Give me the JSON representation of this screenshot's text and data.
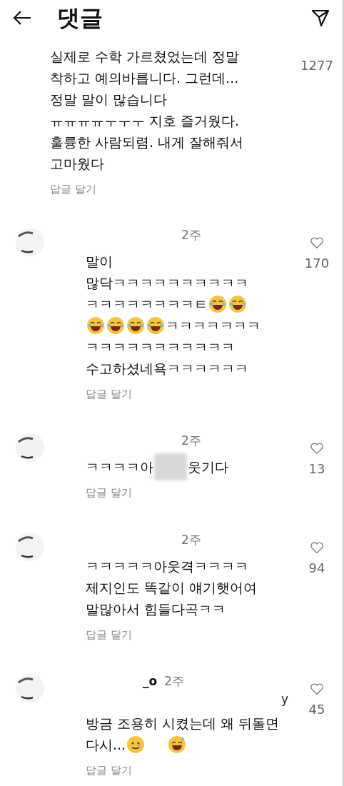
{
  "header": {
    "title": "댓글"
  },
  "comments": [
    {
      "likes": "1277",
      "reply": "답글 달기",
      "lines": [
        [
          {
            "kind": "text",
            "text": "실제로 수학 가르쳤었는데 정말"
          }
        ],
        [
          {
            "kind": "text",
            "text": "착하고 예의바릅니다. 그런데..."
          }
        ],
        [
          {
            "kind": "text",
            "text": "정말 말이 많습니다"
          }
        ],
        [
          {
            "kind": "text",
            "text": "ㅠㅠㅠㅠㅜㅜㅜ 지호 즐거웠다."
          }
        ],
        [
          {
            "kind": "text",
            "text": "훌륭한 사람되렴. 내게 잘해줘서"
          }
        ],
        [
          {
            "kind": "text",
            "text": "고마웠다"
          }
        ]
      ]
    },
    {
      "time": "2주",
      "likes": "170",
      "reply": "답글 달기",
      "lines": [
        [
          {
            "kind": "text",
            "text": "말이"
          }
        ],
        [
          {
            "kind": "text",
            "text": "많닥ㅋㅋㅋㅋㅋㅋㅋㅋㅋㅋ"
          }
        ],
        [
          {
            "kind": "text",
            "text": "ㅋㅋㅋㅋㅋㅋㅋㅋㅌ"
          },
          {
            "kind": "laughing"
          },
          {
            "kind": "laughing"
          }
        ],
        [
          {
            "kind": "laughing"
          },
          {
            "kind": "laughing"
          },
          {
            "kind": "laughing"
          },
          {
            "kind": "laughing"
          },
          {
            "kind": "text",
            "text": "ㅋㅋㅋㅋㅋㅋㅋ"
          }
        ],
        [
          {
            "kind": "text",
            "text": "ㅋㅋㅋㅋㅋㅋㅋㅋㅋㅋㅋ"
          }
        ],
        [
          {
            "kind": "text",
            "text": "수고하셨네욕ㅋㅋㅋㅋㅋㅋ"
          }
        ]
      ]
    },
    {
      "time": "2주",
      "likes": "13",
      "reply": "답글 달기",
      "lines": [
        [
          {
            "kind": "text",
            "text": "ㅋㅋㅋㅋ아"
          },
          {
            "kind": "blur"
          },
          {
            "kind": "text",
            "text": "웃기다"
          }
        ]
      ]
    },
    {
      "time": "2주",
      "likes": "94",
      "reply": "답글 달기",
      "lines": [
        [
          {
            "kind": "text",
            "text": "ㅋㅋㅋㅋㅋ아웃격ㅋㅋㅋㅋ"
          }
        ],
        [
          {
            "kind": "text",
            "text": "제지인도 똑같이 얘기햇어여"
          }
        ],
        [
          {
            "kind": "text",
            "text": "말많아서 힘들다곡ㅋㅋ"
          }
        ]
      ]
    },
    {
      "username": "_o",
      "time": "2주",
      "username_tail": "y",
      "likes": "45",
      "reply": "답글 달기",
      "lines": [
        [
          {
            "kind": "text",
            "text": "방금 조용히 시켰는데 왜 뒤돌면"
          }
        ],
        [
          {
            "kind": "text",
            "text": "다시..."
          },
          {
            "kind": "teary"
          },
          {
            "kind": "gap"
          },
          {
            "kind": "sweating"
          }
        ]
      ]
    }
  ]
}
